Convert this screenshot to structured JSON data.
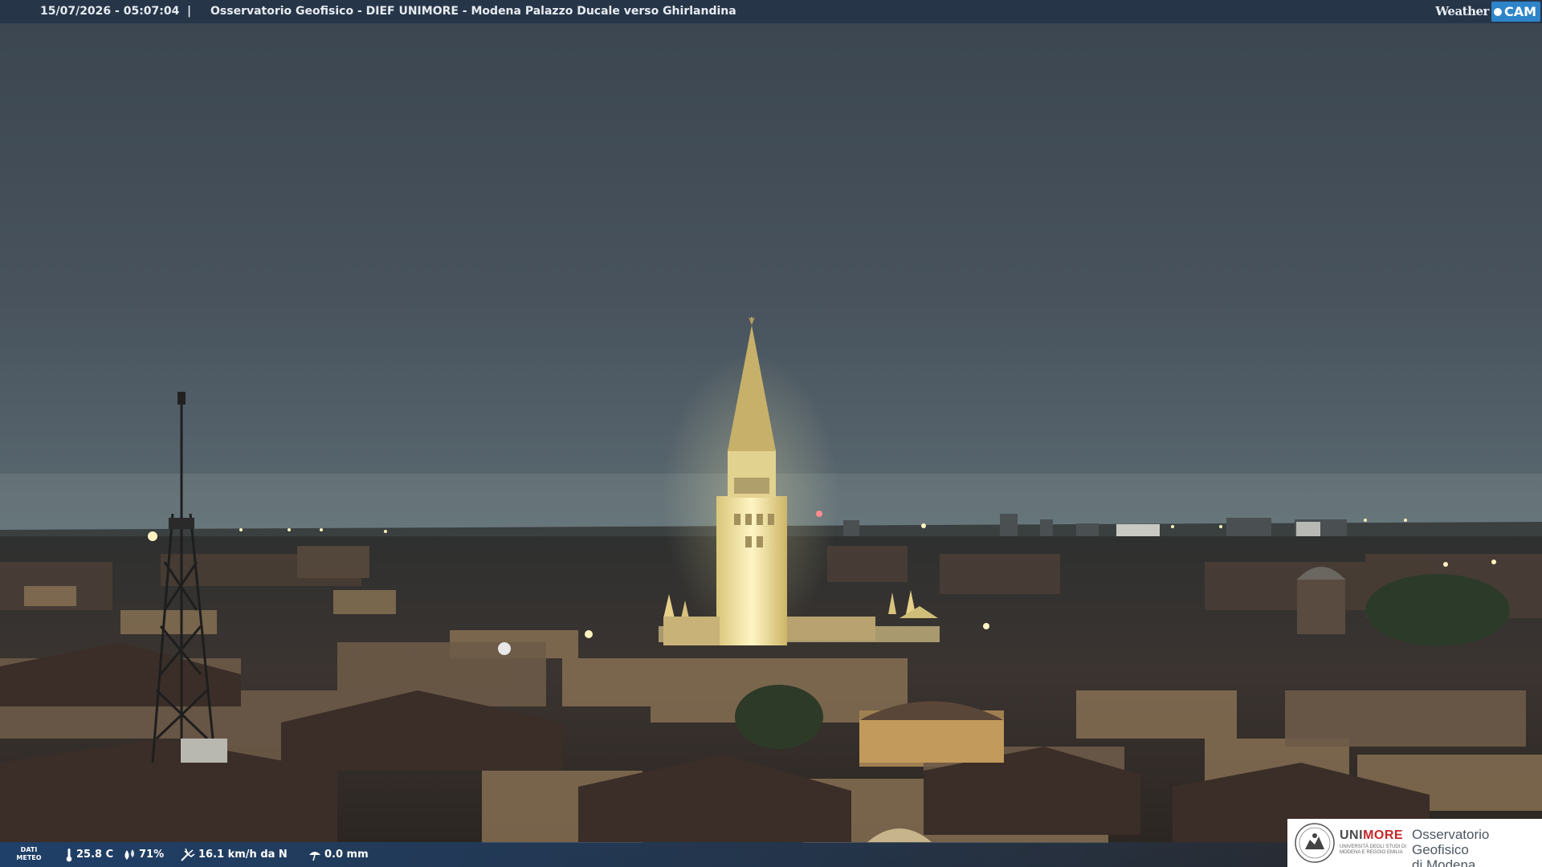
{
  "header": {
    "timestamp": "15/07/2026 - 05:07:04",
    "separator": "|",
    "title": "Osservatorio Geofisico - DIEF UNIMORE - Modena Palazzo Ducale verso Ghirlandina"
  },
  "brand": {
    "weather": "Weather",
    "cam": "CAM"
  },
  "weather_bar": {
    "label_line1": "DATI",
    "label_line2": "METEO",
    "temperature": "25.8 C",
    "humidity": "71%",
    "wind": "16.1 km/h da N",
    "rain": "0.0 mm",
    "icons": [
      "thermometer-icon",
      "humidity-icon",
      "wind-icon",
      "rain-gauge-icon"
    ]
  },
  "logo": {
    "uni": "UNI",
    "more": "MORE",
    "subtitle": "UNIVERSITÀ DEGLI STUDI DI MODENA E REGGIO EMILIA",
    "observatory_line1": "Osservatorio Geofisico",
    "observatory_line2": "di Modena"
  },
  "colors": {
    "bar": "#263448",
    "brand_blue": "#2e84c9",
    "unimore_red": "#c62828"
  }
}
